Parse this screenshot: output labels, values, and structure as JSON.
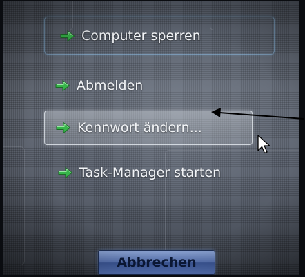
{
  "options": [
    {
      "label": "Computer sperren",
      "icon": "green-arrow-icon"
    },
    {
      "label": "Abmelden",
      "icon": "green-arrow-icon"
    },
    {
      "label": "Kennwort ändern...",
      "icon": "green-arrow-icon"
    },
    {
      "label": "Task-Manager starten",
      "icon": "green-arrow-icon"
    }
  ],
  "cancel_label": "Abbrechen",
  "colors": {
    "arrow_green": "#37b54a",
    "focus_border": "#8cbee6",
    "button_blue": "#5c78b8",
    "annotation_arrow": "#000000"
  }
}
